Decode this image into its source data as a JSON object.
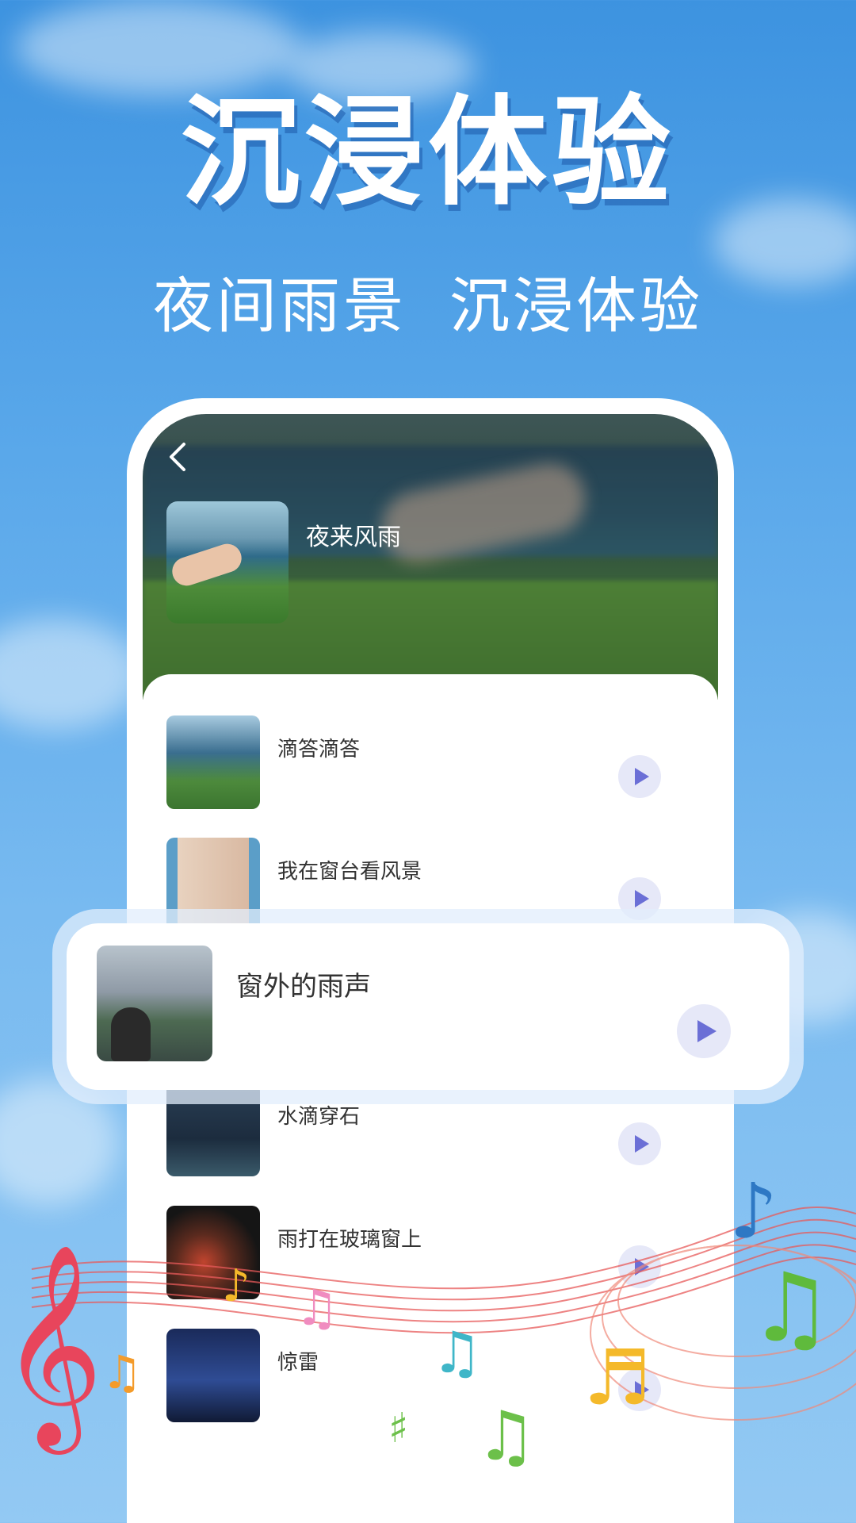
{
  "hero": {
    "title": "沉浸体验",
    "subtitle_left": "夜间雨景",
    "subtitle_right": "沉浸体验"
  },
  "player": {
    "back_icon": "chevron-left-icon",
    "album_title": "夜来风雨"
  },
  "tracks": [
    {
      "title": "滴答滴答"
    },
    {
      "title": "我在窗台看风景"
    },
    {
      "title": "水滴穿石"
    },
    {
      "title": "雨打在玻璃窗上"
    },
    {
      "title": "惊雷"
    }
  ],
  "featured_track": {
    "title": "窗外的雨声"
  },
  "colors": {
    "sky_top": "#3d93e0",
    "sky_bottom": "#93c9f3",
    "play_button_bg": "#e6e8f8",
    "play_icon": "#6b6fd6"
  }
}
